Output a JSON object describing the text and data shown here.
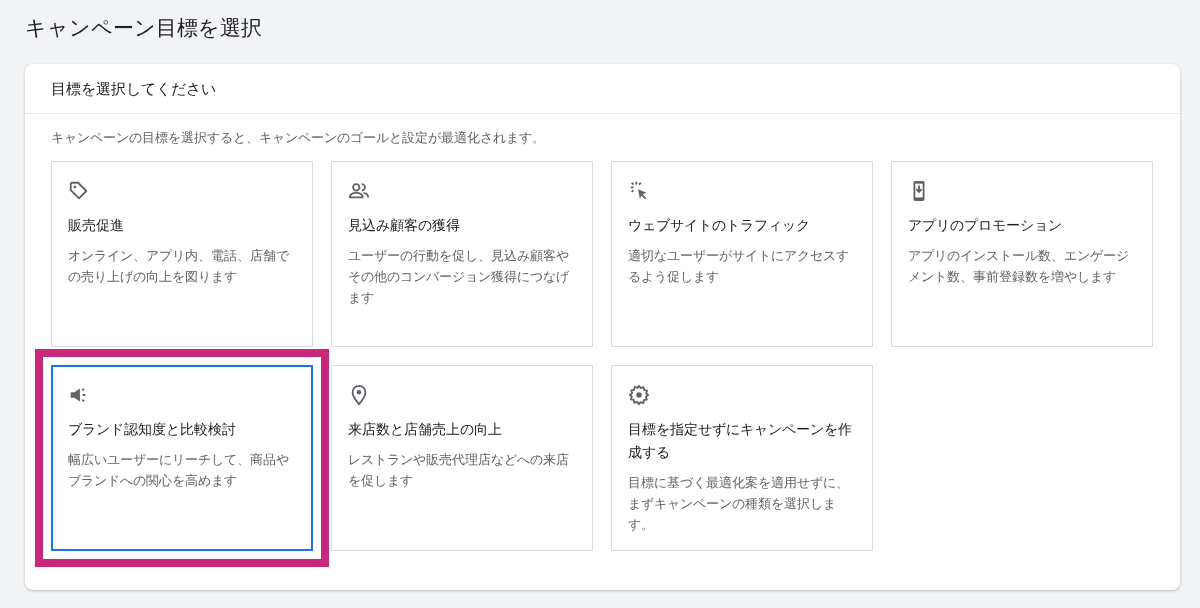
{
  "page": {
    "title": "キャンペーン目標を選択"
  },
  "panel": {
    "header": "目標を選択してください",
    "description": "キャンペーンの目標を選択すると、キャンペーンのゴールと設定が最適化されます。",
    "goals": [
      {
        "kind": "tag",
        "title": "販売促進",
        "description": "オンライン、アプリ内、電話、店舗での売り上げの向上を図ります",
        "selected": false
      },
      {
        "kind": "people",
        "title": "見込み顧客の獲得",
        "description": "ユーザーの行動を促し、見込み顧客やその他のコンバージョン獲得につなげます",
        "selected": false
      },
      {
        "kind": "click",
        "title": "ウェブサイトのトラフィック",
        "description": "適切なユーザーがサイトにアクセスするよう促します",
        "selected": false
      },
      {
        "kind": "phone",
        "title": "アプリのプロモーション",
        "description": "アプリのインストール数、エンゲージメント数、事前登録数を増やします",
        "selected": false
      },
      {
        "kind": "megaphone",
        "title": "ブランド認知度と比較検討",
        "description": "幅広いユーザーにリーチして、商品やブランドへの関心を高めます",
        "selected": true
      },
      {
        "kind": "pin",
        "title": "来店数と店舗売上の向上",
        "description": "レストランや販売代理店などへの来店を促します",
        "selected": false
      },
      {
        "kind": "gear",
        "title": "目標を指定せずにキャンペーンを作成する",
        "description": "目標に基づく最適化案を適用せずに、まずキャンペーンの種類を選択します。",
        "selected": false
      }
    ]
  }
}
